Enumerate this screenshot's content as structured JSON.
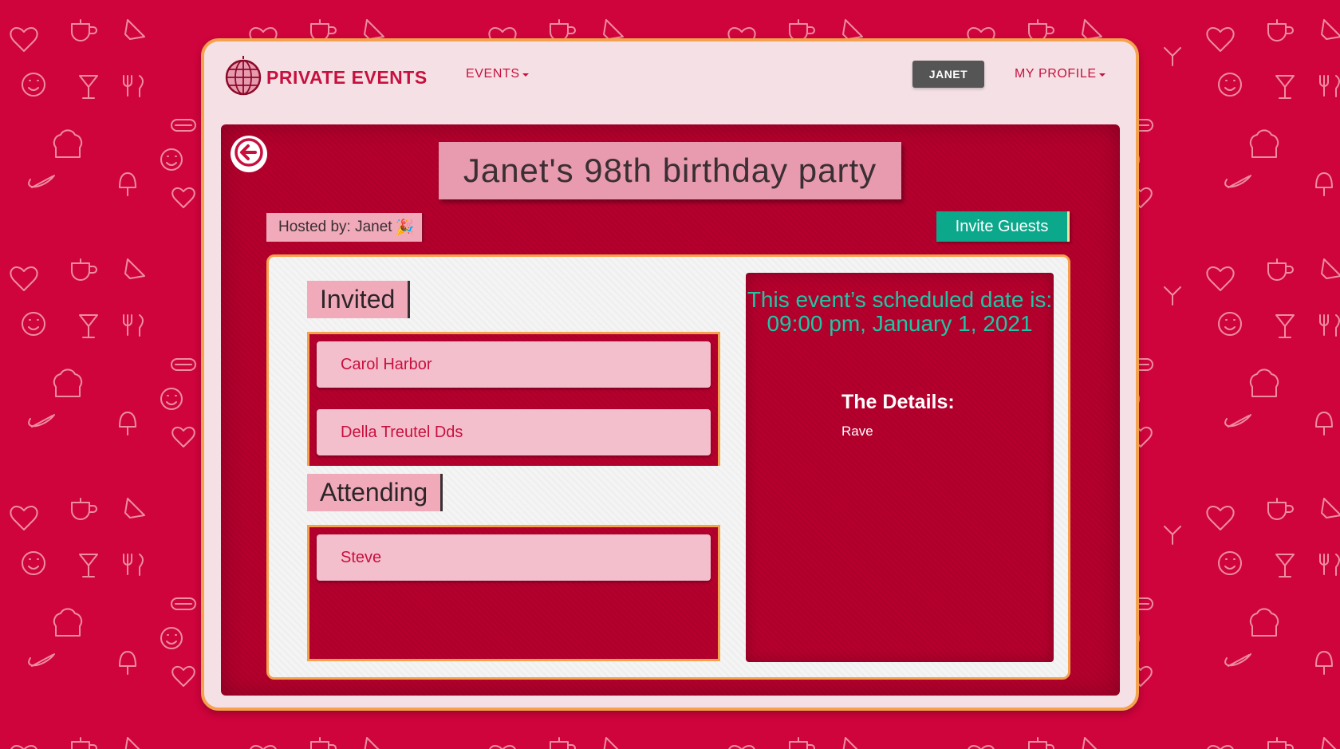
{
  "nav": {
    "brand": "PRIVATE EVENTS",
    "events_label": "EVENTS",
    "user_badge": "JANET",
    "profile_label": "MY PROFILE"
  },
  "event": {
    "title": "Janet's 98th birthday party",
    "hosted_by": "Hosted by: Janet",
    "hosted_emoji": "🎉",
    "invite_button": "Invite Guests",
    "invited_label": "Invited",
    "invited": [
      "Carol Harbor",
      "Della Treutel Dds"
    ],
    "attending_label": "Attending",
    "attending": [
      "Steve"
    ],
    "schedule_text": "This event’s scheduled date is: 09:00 pm, January 1, 2021",
    "details_title": "The Details:",
    "details_text": "Rave"
  },
  "colors": {
    "background": "#d0043c",
    "brand_red": "#c8103e",
    "frame_border": "#f4a24e",
    "teal": "#0ba88b",
    "pink": "#f0aab9"
  },
  "icons": {
    "logo": "disco-ball-icon",
    "back": "back-arrow-icon"
  }
}
